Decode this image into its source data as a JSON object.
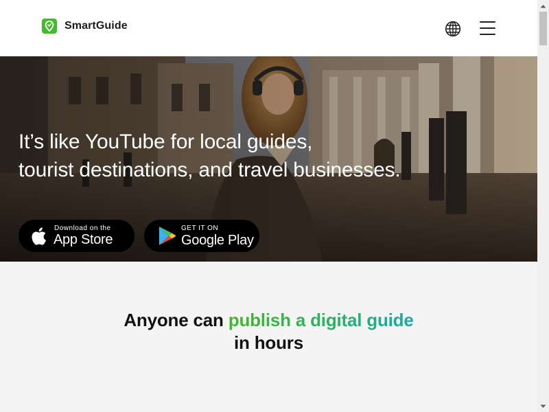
{
  "header": {
    "logo_text": "SmartGuide",
    "brand_color": "#44bb2c",
    "icons": {
      "logo": "location-pin-icon",
      "language": "globe-icon",
      "menu": "hamburger-menu-icon"
    }
  },
  "hero": {
    "title_line1": "It’s like YouTube for local guides,",
    "title_line2": "tourist destinations, and travel businesses.",
    "app_store": {
      "small": "Download on the",
      "big": "App Store",
      "icon": "apple-icon"
    },
    "google_play": {
      "small": "GET IT ON",
      "big": "Google Play",
      "icon": "google-play-icon"
    }
  },
  "section": {
    "title_part1": "Anyone can ",
    "title_highlight": "publish a digital guide",
    "title_part2": "in hours",
    "highlight_colors": [
      "#48b52c",
      "#1aa8a8"
    ]
  }
}
